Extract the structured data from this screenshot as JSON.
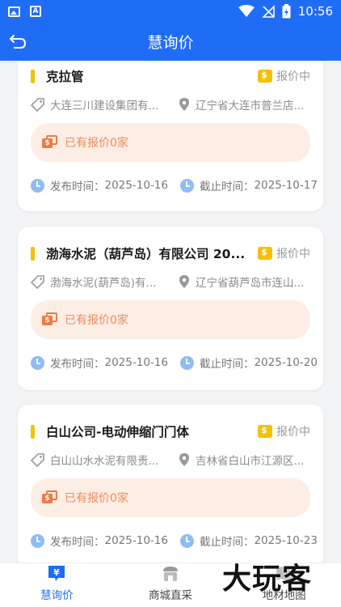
{
  "status_bar": {
    "time": "10:56"
  },
  "header": {
    "title": "慧询价"
  },
  "cards": [
    {
      "title": "克拉管",
      "status": "报价中",
      "company": "大连三川建设集团有...",
      "location": "辽宁省大连市普兰店...",
      "quote_text": "已有报价0家",
      "publish_label": "发布时间：",
      "publish_date": "2025-10-16",
      "deadline_label": "截止时间：",
      "deadline_date": "2025-10-17"
    },
    {
      "title": "渤海水泥（葫芦岛）有限公司 20...",
      "status": "报价中",
      "company": "渤海水泥(葫芦岛)有...",
      "location": "辽宁省葫芦岛市连山...",
      "quote_text": "已有报价0家",
      "publish_label": "发布时间：",
      "publish_date": "2025-10-16",
      "deadline_label": "截止时间：",
      "deadline_date": "2025-10-20"
    },
    {
      "title": "白山公司-电动伸缩门门体",
      "status": "报价中",
      "company": "白山山水水泥有限责...",
      "location": "吉林省白山市江源区...",
      "quote_text": "已有报价0家",
      "publish_label": "发布时间：",
      "publish_date": "2025-10-16",
      "deadline_label": "截止时间：",
      "deadline_date": "2025-10-23"
    }
  ],
  "tabs": [
    {
      "label": "慧询价",
      "icon": "inquiry-icon",
      "active": true
    },
    {
      "label": "商城直采",
      "icon": "store-icon",
      "active": false
    },
    {
      "label": "地材地图",
      "icon": "map-icon",
      "active": false
    }
  ],
  "watermark": "大玩客",
  "colors": {
    "primary": "#1f6cf5",
    "accent": "#f5c000",
    "quote": "#ef8a5a"
  }
}
